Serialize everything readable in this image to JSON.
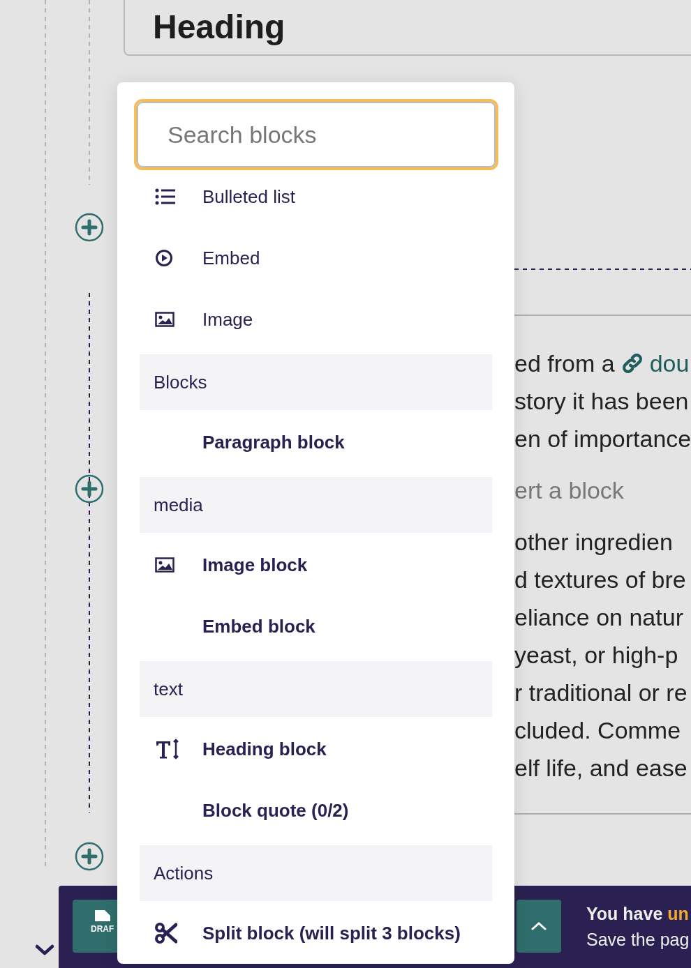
{
  "heading": {
    "text": "Heading"
  },
  "body_lines": [
    {
      "kind": "text",
      "text": "ed from a",
      "link": "dou"
    },
    {
      "kind": "text",
      "text": "story it has been"
    },
    {
      "kind": "text",
      "text": "en of importance"
    },
    {
      "kind": "placeholder",
      "text": "ert a block"
    },
    {
      "kind": "text",
      "text": "other ingredien"
    },
    {
      "kind": "text",
      "text": "d textures of bre"
    },
    {
      "kind": "text",
      "text": "eliance on natur"
    },
    {
      "kind": "text",
      "text": "yeast, or high-p"
    },
    {
      "kind": "text",
      "text": "r traditional or re"
    },
    {
      "kind": "text",
      "text": "cluded. Comme"
    },
    {
      "kind": "text",
      "text": "elf life, and ease"
    }
  ],
  "block_menu": {
    "search": {
      "placeholder": "Search blocks"
    },
    "suggestions": [
      {
        "kind": "list",
        "label": "Bulleted list"
      },
      {
        "kind": "embed",
        "label": "Embed"
      },
      {
        "kind": "image",
        "label": "Image"
      }
    ],
    "groups": [
      {
        "title": "Blocks",
        "items": [
          {
            "kind": "plain",
            "label": "Paragraph block"
          }
        ]
      },
      {
        "title": "media",
        "items": [
          {
            "kind": "image",
            "label": "Image block"
          },
          {
            "kind": "plain",
            "label": "Embed block"
          }
        ]
      },
      {
        "title": "text",
        "items": [
          {
            "kind": "heading",
            "label": "Heading block"
          },
          {
            "kind": "plain",
            "label": "Block quote (0/2)"
          }
        ]
      },
      {
        "title": "Actions",
        "items": [
          {
            "kind": "split",
            "label": "Split block (will split 3 blocks)"
          }
        ]
      }
    ]
  },
  "footer": {
    "draft_label": "DRAF",
    "title": "You have ",
    "title_highlight": "un",
    "subtitle": "Save the pag"
  }
}
